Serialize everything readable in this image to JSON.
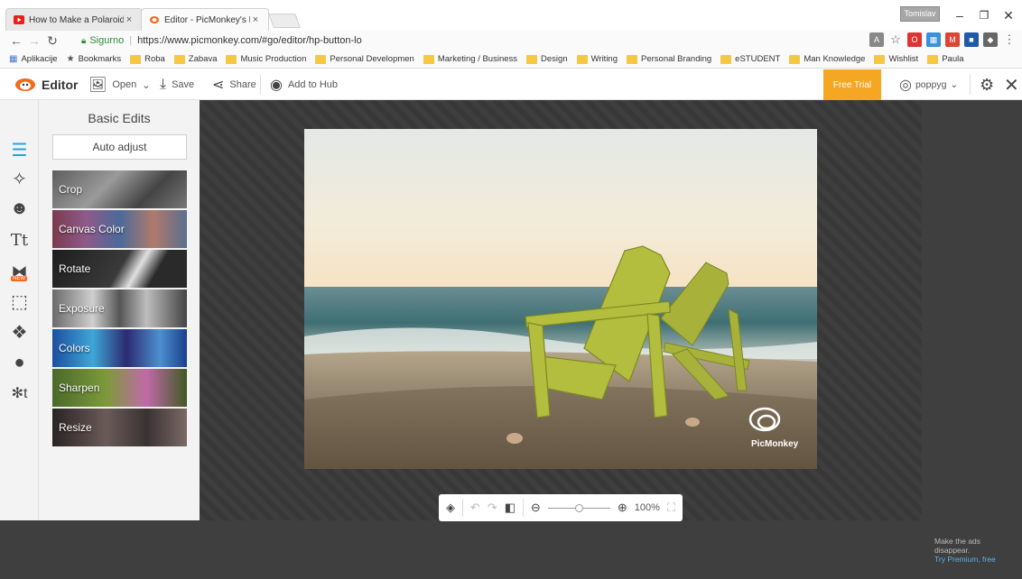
{
  "browser": {
    "tabs": [
      {
        "title": "How to Make a Polaroid",
        "active": false
      },
      {
        "title": "Editor - PicMonkey's Pho",
        "active": true
      }
    ],
    "profile_label": "Tomislav",
    "secure_label": "Sigurno",
    "url": "https://www.picmonkey.com/#go/editor/hp-button-lo",
    "bookmarks": [
      "Aplikacije",
      "Bookmarks",
      "Roba",
      "Zabava",
      "Music Production",
      "Personal Developmen",
      "Marketing / Business",
      "Design",
      "Writing",
      "Personal Branding",
      "eSTUDENT",
      "Man Knowledge",
      "Wishlist",
      "Paula"
    ],
    "colors": {
      "secure": "#2e8b3d",
      "folder": "#f5c842"
    }
  },
  "toolbar": {
    "editor_label": "Editor",
    "open_label": "Open",
    "save_label": "Save",
    "share_label": "Share",
    "hub_label": "Add to Hub",
    "free_trial_label": "Free Trial",
    "username": "poppyg",
    "colors": {
      "brand": "#f26a1b",
      "trial": "#f5a623"
    }
  },
  "panel": {
    "title": "Basic Edits",
    "auto_adjust_label": "Auto adjust",
    "tools": [
      "Crop",
      "Canvas Color",
      "Rotate",
      "Exposure",
      "Colors",
      "Sharpen",
      "Resize"
    ]
  },
  "rail": {
    "icons": [
      "basic-edits-icon",
      "effects-icon",
      "touch-up-icon",
      "text-icon",
      "themes-icon",
      "frames-icon",
      "textures-icon",
      "overlays-icon",
      "graphics-icon"
    ],
    "new_badge": "NEW"
  },
  "canvas": {
    "watermark": "PicMonkey",
    "zoom_level": "100%"
  },
  "ads": {
    "line1": "Make the ads",
    "line2": "disappear.",
    "link": "Try Premium, free"
  }
}
